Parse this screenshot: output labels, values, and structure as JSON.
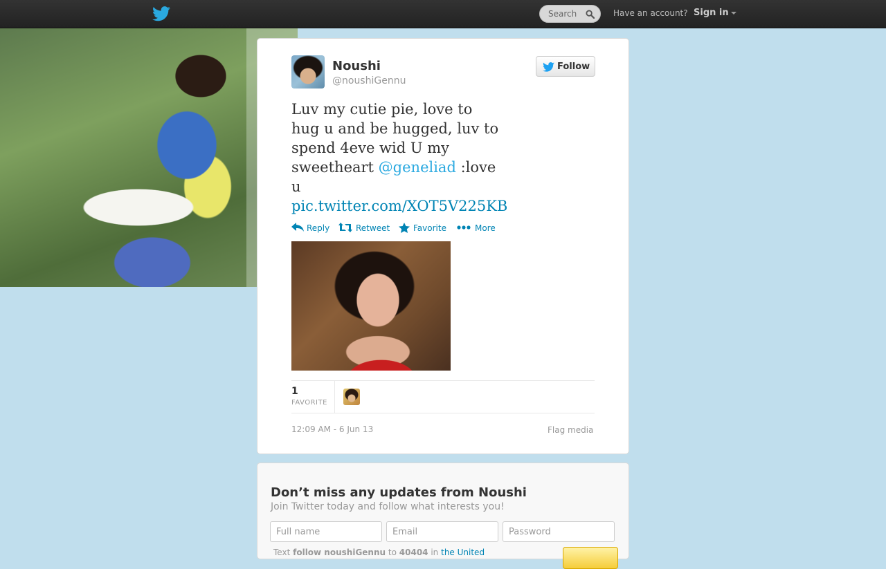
{
  "topbar": {
    "search_placeholder": "Search",
    "have_account": "Have an account?",
    "sign_in": "Sign in"
  },
  "tweet": {
    "name": "Noushi",
    "handle": "@noushiGennu",
    "follow_label": "Follow",
    "text_before": "Luv my cutie pie, love to hug u and be hugged, luv to spend 4eve wid U my sweetheart ",
    "mention": "@geneliad",
    "text_after": " :love u ",
    "pic_link": "pic.twitter.com/XOT5V225KB",
    "actions": {
      "reply": "Reply",
      "retweet": "Retweet",
      "favorite": "Favorite",
      "more": "More"
    },
    "favorite_count": "1",
    "favorite_label": "FAVORITE",
    "timestamp": "12:09 AM - 6 Jun 13",
    "flag_media": "Flag media"
  },
  "signup": {
    "title": "Don’t miss any updates from Noushi",
    "subtitle": "Join Twitter today and follow what interests you!",
    "fullname_placeholder": "Full name",
    "email_placeholder": "Email",
    "password_placeholder": "Password",
    "text_prefix": "Text",
    "text_command": "follow noushiGennu",
    "text_to": "to",
    "text_number": "40404",
    "text_in": "in",
    "text_country": "the United"
  },
  "colors": {
    "link": "#0084b4",
    "mention": "#2aa9e0",
    "background": "#c0deed",
    "twitter_blue": "#1da1f2"
  }
}
